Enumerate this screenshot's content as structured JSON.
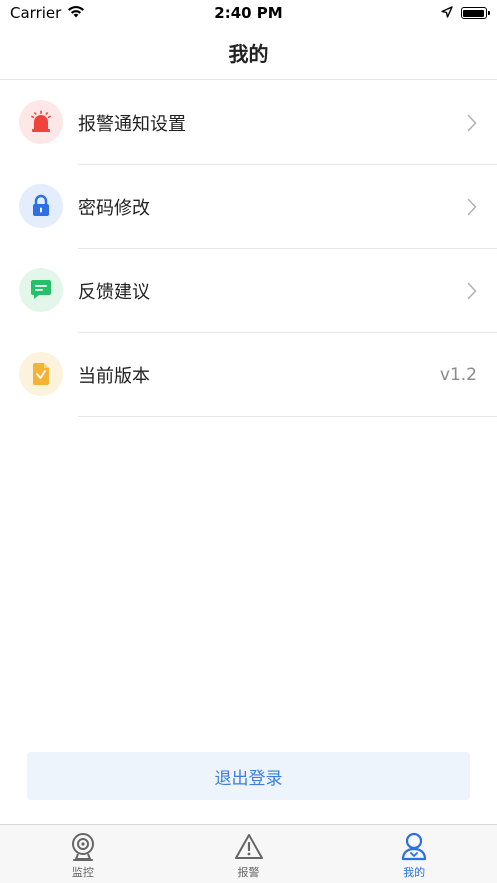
{
  "status_bar": {
    "carrier": "Carrier",
    "time": "2:40 PM",
    "icons": [
      "wifi-icon",
      "location-arrow-icon",
      "battery-icon"
    ]
  },
  "header": {
    "title": "我的"
  },
  "menu": {
    "items": [
      {
        "label": "报警通知设置",
        "icon": "alarm-siren-icon",
        "icon_color": "#f0433a",
        "icon_bg": "#fde8e7"
      },
      {
        "label": "密码修改",
        "icon": "lock-icon",
        "icon_color": "#2f6fe6",
        "icon_bg": "#e4edfb"
      },
      {
        "label": "反馈建议",
        "icon": "message-icon",
        "icon_color": "#27c06a",
        "icon_bg": "#e3f6ea"
      },
      {
        "label": "当前版本",
        "icon": "document-check-icon",
        "icon_color": "#f5b335",
        "icon_bg": "#fdf2dc",
        "value": "v1.2"
      }
    ]
  },
  "logout": {
    "label": "退出登录"
  },
  "tab_bar": {
    "tabs": [
      {
        "label": "监控",
        "icon": "camera-icon",
        "active": false
      },
      {
        "label": "报警",
        "icon": "warning-icon",
        "active": false
      },
      {
        "label": "我的",
        "icon": "user-icon",
        "active": true
      }
    ]
  },
  "colors": {
    "accent": "#2b6fe0",
    "logout_bg": "#eef4fb",
    "logout_text": "#3a7ee6"
  }
}
